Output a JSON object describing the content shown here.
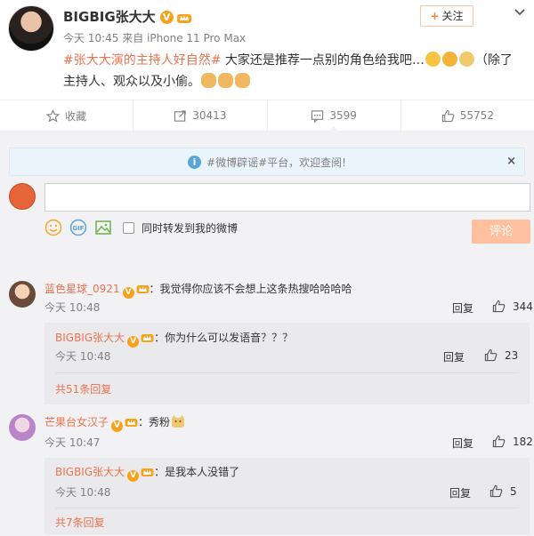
{
  "post": {
    "author": "BIGBIG张大大",
    "time": "今天 10:45",
    "source_prefix": "来自",
    "device": "iPhone 11 Pro Max",
    "follow_label": "关注",
    "topic": "#张大大演的主持人好自然#",
    "text_main": " 大家还是推荐一点别的角色给我吧…",
    "text_paren_line1": "（除了",
    "text_line2": "主持人、观众以及小偷。"
  },
  "actions": {
    "favorite_label": "收藏",
    "forward_count": "30413",
    "comment_count": "3599",
    "like_count": "55752"
  },
  "notice": {
    "text": "#微博辟谣#平台，欢迎查阅!",
    "close": "×"
  },
  "composer": {
    "input_value": "",
    "also_forward_label": "同时转发到我的微博",
    "submit_label": "评论"
  },
  "comments": [
    {
      "user": "蓝色星球_0921",
      "text": "：我觉得你应该不会想上这条热搜哈哈哈哈",
      "time": "今天 10:48",
      "reply_label": "回复",
      "likes": "344",
      "sub": {
        "user": "BIGBIG张大大",
        "text": "：你为什么可以发语音？？？",
        "time": "今天 10:48",
        "reply_label": "回复",
        "likes": "23",
        "more": "共51条回复"
      }
    },
    {
      "user": "芒果台女汉子",
      "text": "：秀粉",
      "time": "今天 10:47",
      "reply_label": "回复",
      "likes": "182",
      "sub": {
        "user": "BIGBIG张大大",
        "text": "：是我本人没错了",
        "time": "今天 10:48",
        "reply_label": "回复",
        "likes": "5",
        "more": "共7条回复"
      }
    }
  ],
  "colors": {
    "accent": "#eb7350",
    "badge": "#f7a21a",
    "submit_disabled": "#ffc09f",
    "page_bg": "#f2f2f5"
  },
  "icons": [
    "star-icon",
    "forward-icon",
    "comment-icon",
    "thumbs-up-icon",
    "info-icon",
    "smiley-icon",
    "gif-icon",
    "image-icon",
    "chevron-down-icon",
    "verified-v-icon",
    "crown-badge-icon"
  ]
}
